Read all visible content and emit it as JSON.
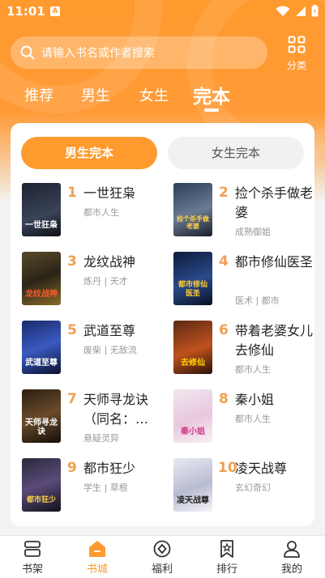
{
  "status_bar": {
    "time": "11:01",
    "notification_badge": "A"
  },
  "search": {
    "placeholder": "请输入书名或作者搜索"
  },
  "category_label": "分类",
  "tabs": [
    {
      "label": "推荐"
    },
    {
      "label": "男生"
    },
    {
      "label": "女生"
    },
    {
      "label": "完本",
      "active": true
    }
  ],
  "segments": {
    "male": "男生完本",
    "female": "女生完本",
    "selected": "male"
  },
  "books": [
    {
      "rank": "1",
      "title": "一世狂枭",
      "tags": "都市人生",
      "cover_text": "一世狂枭"
    },
    {
      "rank": "2",
      "title": "捡个杀手做老婆",
      "tags": "成熟御姐",
      "cover_text": "捡个杀手做老婆"
    },
    {
      "rank": "3",
      "title": "龙纹战神",
      "tags": "炼丹 | 天才",
      "cover_text": "龙纹战神"
    },
    {
      "rank": "4",
      "title": "都市修仙医圣",
      "tags": "医术 | 都市",
      "cover_text": "都市修仙医圣"
    },
    {
      "rank": "5",
      "title": "武道至尊",
      "tags": "废柴 | 无敌流",
      "cover_text": "武道至尊"
    },
    {
      "rank": "6",
      "title": "带着老婆女儿去修仙",
      "tags": "都市人生",
      "cover_text": "去修仙"
    },
    {
      "rank": "7",
      "title": "天师寻龙诀（同名：…",
      "tags": "悬疑灵异",
      "cover_text": "天师寻龙诀"
    },
    {
      "rank": "8",
      "title": "秦小姐",
      "tags": "都市人生",
      "cover_text": "秦小姐"
    },
    {
      "rank": "9",
      "title": "都市狂少",
      "tags": "学生 | 草根",
      "cover_text": "都市狂少"
    },
    {
      "rank": "10",
      "title": "凌天战尊",
      "tags": "玄幻奇幻",
      "cover_text": "凌天战尊"
    }
  ],
  "bottom_nav": [
    {
      "label": "书架"
    },
    {
      "label": "书城",
      "active": true
    },
    {
      "label": "福利"
    },
    {
      "label": "排行"
    },
    {
      "label": "我的"
    }
  ],
  "colors": {
    "accent": "#ff9a2e",
    "rank": "#f0a050"
  }
}
